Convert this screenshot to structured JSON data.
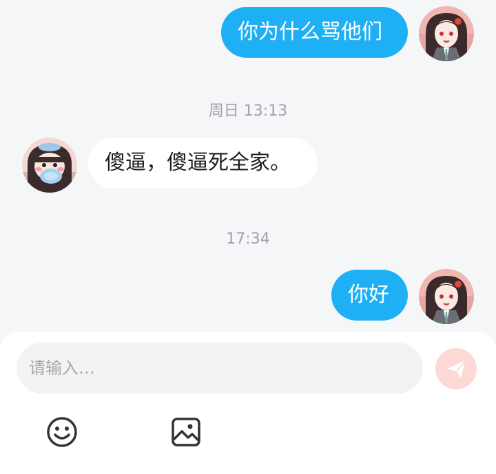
{
  "messages": [
    {
      "side": "out",
      "text": "你为什么骂他们"
    },
    {
      "timestamp": "周日 13:13"
    },
    {
      "side": "in",
      "text": "傻逼，傻逼死全家。"
    },
    {
      "timestamp": "17:34"
    },
    {
      "side": "out",
      "text": "你好"
    }
  ],
  "composer": {
    "placeholder": "请输入…",
    "send_icon": "paper-plane-icon",
    "tools": [
      "emoji-icon",
      "image-icon"
    ]
  },
  "colors": {
    "outgoing_bubble": "#1eaff5",
    "incoming_bubble": "#ffffff",
    "background": "#f5f6f8",
    "send_button": "#fdd9d6",
    "timestamp_text": "#9fa2a8"
  }
}
